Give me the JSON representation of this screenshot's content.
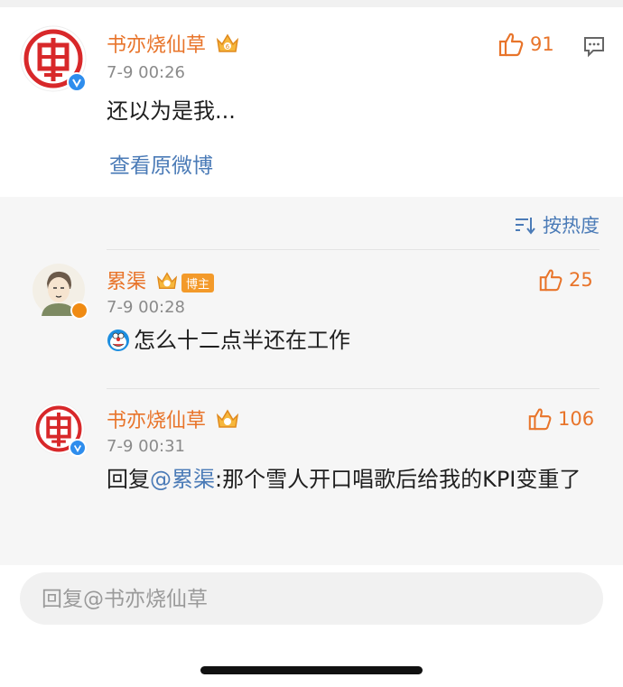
{
  "post": {
    "username": "书亦烧仙草",
    "time": "7-9 00:26",
    "content": "还以为是我...",
    "like_count": "91",
    "view_original": "查看原微博"
  },
  "sort": {
    "label": "按热度"
  },
  "comments": [
    {
      "username": "累渠",
      "badge": "博主",
      "time": "7-9 00:28",
      "content": "怎么十二点半还在工作",
      "like_count": "25"
    },
    {
      "username": "书亦烧仙草",
      "time": "7-9 00:31",
      "reply_prefix": "回复",
      "mention": "@累渠",
      "content": ":那个雪人开口唱歌后给我的KPI变重了",
      "like_count": "106"
    }
  ],
  "reply_input": {
    "placeholder": "回复@书亦烧仙草",
    "value": ""
  },
  "colors": {
    "username": "#e8742a",
    "link": "#4b7bb7",
    "verified": "#2e8ded"
  },
  "icons": [
    "thumbs-up-icon",
    "comment-icon",
    "crown-icon",
    "verified-icon",
    "sort-icon",
    "doraemon-emoji-icon"
  ]
}
